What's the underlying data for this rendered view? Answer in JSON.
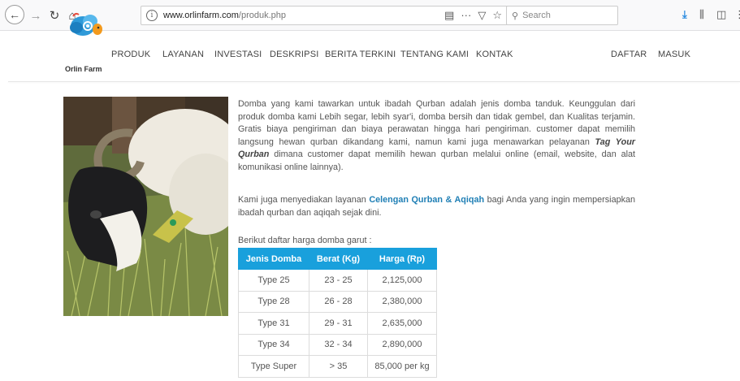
{
  "browser": {
    "url_domain": "www.orlinfarm.com",
    "url_path": "/produk.php",
    "search_placeholder": "Search",
    "icons": [
      "back-icon",
      "forward-icon",
      "reload-icon",
      "home-icon",
      "info-icon",
      "reader-view-icon",
      "more-icon",
      "pocket-icon",
      "bookmark-star-icon",
      "search-icon",
      "download-icon",
      "library-icon",
      "sidebar-icon",
      "menu-icon"
    ]
  },
  "site": {
    "logo_text": "Orlin Farm",
    "nav": [
      "PRODUK",
      "LAYANAN",
      "INVESTASI",
      "DESKRIPSI",
      "BERITA TERKINI",
      "TENTANG KAMI",
      "KONTAK"
    ],
    "nav_right": [
      "DAFTAR",
      "MASUK"
    ],
    "accent": "#19a0dc"
  },
  "content": {
    "p1_a": "Domba yang kami tawarkan untuk ibadah Qurban adalah jenis domba tanduk. Keunggulan dari produk domba kami Lebih segar, lebih syar'i, domba bersih dan tidak gembel, dan Kualitas terjamin. Gratis biaya pengiriman dan biaya perawatan hingga hari pengiriman. customer dapat memilih langsung hewan qurban dikandang kami, namun kami juga menawarkan pelayanan ",
    "p1_em": "Tag Your Qurban",
    "p1_b": " dimana customer dapat memilih hewan qurban melalui online (email, website, dan alat komunikasi online lainnya).",
    "p2_a": "Kami juga menyediakan layanan ",
    "p2_link": "Celengan Qurban & Aqiqah",
    "p2_b": " bagi Anda yang ingin mempersiapkan ibadah qurban dan aqiqah sejak dini.",
    "p3": "Berikut daftar harga domba garut :"
  },
  "price_table": {
    "headers": [
      "Jenis Domba",
      "Berat (Kg)",
      "Harga (Rp)"
    ],
    "rows": [
      [
        "Type 25",
        "23 - 25",
        "2,125,000"
      ],
      [
        "Type 28",
        "26 - 28",
        "2,380,000"
      ],
      [
        "Type 31",
        "29 - 31",
        "2,635,000"
      ],
      [
        "Type 34",
        "32 - 34",
        "2,890,000"
      ],
      [
        "Type Super",
        "> 35",
        "85,000 per kg"
      ]
    ]
  }
}
